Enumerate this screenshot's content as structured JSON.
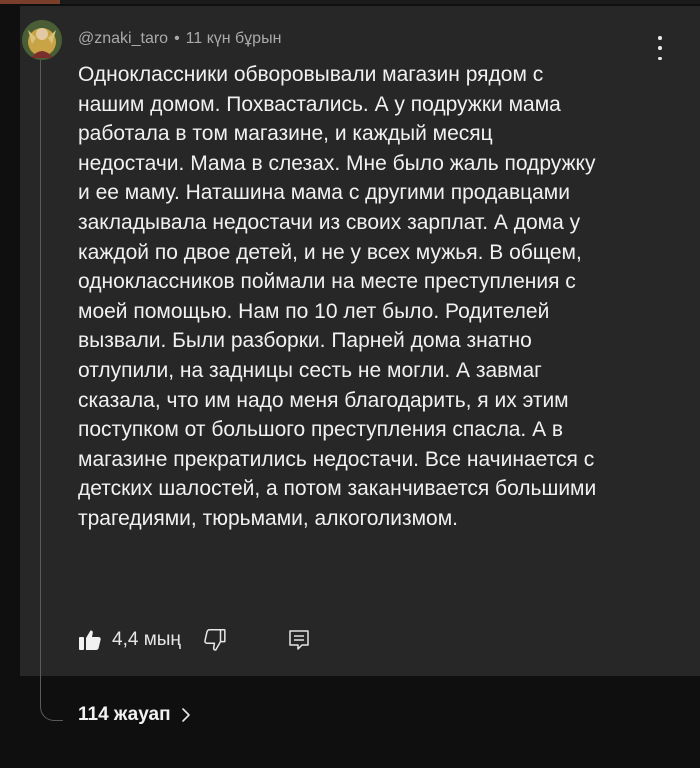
{
  "comment": {
    "author": "@znaki_taro",
    "separator": "•",
    "time": "11 күн бұрын",
    "text": "Одноклассники обворовывали магазин рядом с\nнашим домом. Похвастались. А у подружки мама\nработала в том магазине, и каждый месяц\nнедостачи. Мама в слезах. Мне было жаль подружку\nи ее маму. Наташина мама с другими продавцами\nзакладывала недостачи из своих зарплат. А дома у\nкаждой по двое детей, и не у всех мужья. В общем,\nодноклассников поймали на месте преступления с\nмоей помощью. Нам по 10 лет было. Родителей\nвызвали. Были разборки. Парней дома знатно\nотлупили, на задницы сесть не могли. А завмаг\nсказала, что им надо меня благодарить, я их этим\nпоступком от большого преступления спасла. А в\nмагазине прекратились недостачи. Все начинается с\nдетских шалостей, а потом заканчивается большими\nтрагедиями, тюрьмами, алкоголизмом.",
    "likes": "4,4 мың",
    "replies_label": "114 жауап"
  },
  "icons": {
    "like": "thumbs-up-filled-icon",
    "dislike": "thumbs-down-outline-icon",
    "reply": "reply-comment-icon",
    "menu": "kebab-menu-icon",
    "replies_chevron": "chevron-right-icon"
  },
  "colors": {
    "background": "#0f0f0f",
    "card": "#272727",
    "text": "#f1f1f1",
    "meta": "#aaaaaa"
  }
}
